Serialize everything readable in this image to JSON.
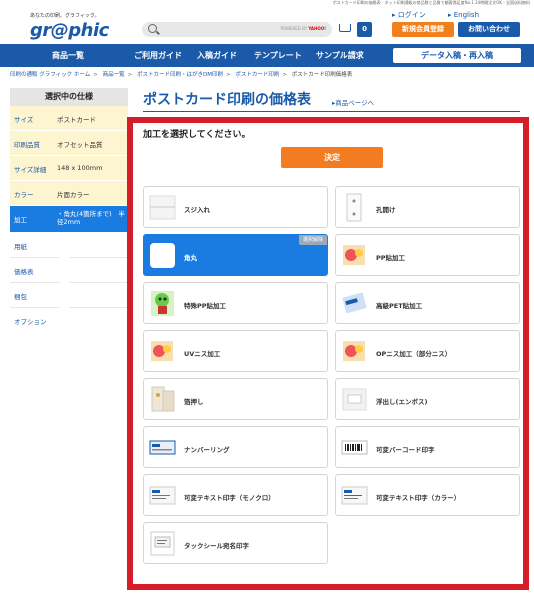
{
  "top_strip": "ポストカード印刷の価格表 - ネット印刷通販の商品数と品質で顧客満足度No.1 24時間注文OK・全国送料無料",
  "header": {
    "tagline": "あなたの印刷、グラフィック。",
    "logo": "gr@phic",
    "search_powered": "POWERED BY",
    "search_brand": "YAHOO!",
    "cart_count": "0",
    "login": "ログイン",
    "english": "English",
    "register": "新規会員登録",
    "contact": "お問い合わせ"
  },
  "nav": {
    "items": [
      "商品一覧",
      "ご利用ガイド",
      "入稿ガイド",
      "テンプレート",
      "サンプル請求"
    ],
    "data_button": "データ入稿・再入稿"
  },
  "breadcrumb": {
    "items": [
      "印刷の通販 グラフィック ホーム",
      "商品一覧",
      "ポストカード印刷・はがきDM印刷",
      "ポストカード印刷"
    ],
    "current": "ポストカード印刷価格表"
  },
  "sidebar": {
    "title": "選択中の仕様",
    "specs": [
      {
        "key": "サイズ",
        "value": "ポストカード"
      },
      {
        "key": "印刷品質",
        "value": "オフセット品質"
      },
      {
        "key": "サイズ詳細",
        "value": "148 x 100mm"
      },
      {
        "key": "カラー",
        "value": "片面カラー"
      },
      {
        "key": "加工",
        "value": "・角丸(4箇所まで)　半径2mm"
      }
    ],
    "steps": [
      "用紙",
      "価格表",
      "梱包",
      "オプション"
    ]
  },
  "main": {
    "title": "ポストカード印刷の価格表",
    "title_link": "商品ページへ",
    "heading": "加工を選択してください。",
    "decide": "決定",
    "selected_tag": "選択解除",
    "options": [
      {
        "label": "スジ入れ",
        "icon": "crease-icon",
        "selected": false
      },
      {
        "label": "孔開け",
        "icon": "hole-punch-icon",
        "selected": false
      },
      {
        "label": "角丸",
        "icon": "rounded-corner-icon",
        "selected": true
      },
      {
        "label": "PP貼加工",
        "icon": "pp-laminate-icon",
        "selected": false
      },
      {
        "label": "特殊PP貼加工",
        "icon": "special-pp-icon",
        "selected": false
      },
      {
        "label": "高級PET貼加工",
        "icon": "pet-laminate-icon",
        "selected": false
      },
      {
        "label": "UVニス加工",
        "icon": "uv-varnish-icon",
        "selected": false
      },
      {
        "label": "OPニス加工（部分ニス）",
        "icon": "op-varnish-icon",
        "selected": false
      },
      {
        "label": "箔押し",
        "icon": "foil-stamp-icon",
        "selected": false
      },
      {
        "label": "浮出し(エンボス)",
        "icon": "emboss-icon",
        "selected": false
      },
      {
        "label": "ナンバーリング",
        "icon": "numbering-icon",
        "selected": false
      },
      {
        "label": "可変バーコード印字",
        "icon": "barcode-icon",
        "selected": false
      },
      {
        "label": "可変テキスト印字（モノクロ）",
        "icon": "variable-text-mono-icon",
        "selected": false
      },
      {
        "label": "可変テキスト印字（カラー）",
        "icon": "variable-text-color-icon",
        "selected": false
      },
      {
        "label": "タックシール宛名印字",
        "icon": "address-label-icon",
        "selected": false
      }
    ]
  },
  "colors": {
    "brand_blue": "#1a5aa8",
    "selected_blue": "#1a7be0",
    "orange": "#f47c20",
    "highlight_red": "#d51d2a",
    "spec_bg": "#fdf4d0"
  }
}
